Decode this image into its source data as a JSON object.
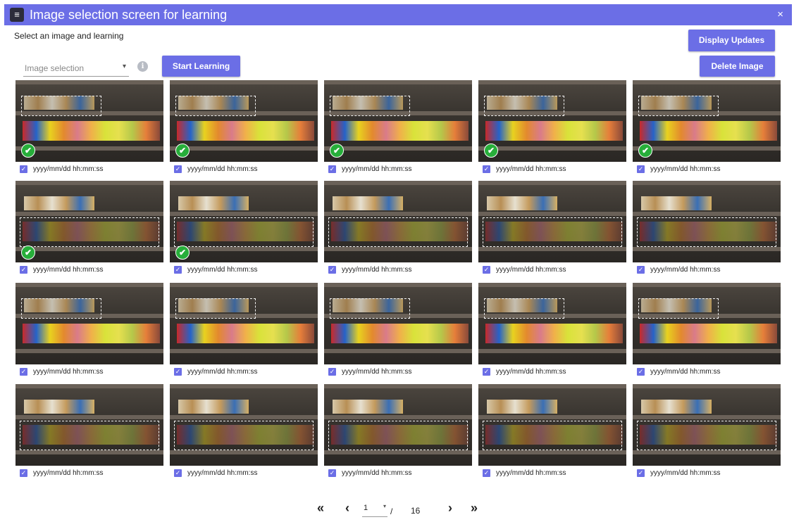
{
  "window": {
    "title": "Image selection screen for learning",
    "close_label": "×"
  },
  "subtitle": "Select an image and learning",
  "image_select": {
    "placeholder": "Image selection",
    "arrow": "▾"
  },
  "info_label": "i",
  "buttons": {
    "start": "Start Learning",
    "display": "Display Updates",
    "delete": "Delete Image"
  },
  "images": [
    {
      "timestamp": "yyyy/mm/dd hh:mm:ss",
      "checked": true,
      "learned": true,
      "variant": "a"
    },
    {
      "timestamp": "yyyy/mm/dd hh:mm:ss",
      "checked": true,
      "learned": true,
      "variant": "a"
    },
    {
      "timestamp": "yyyy/mm/dd hh:mm:ss",
      "checked": true,
      "learned": true,
      "variant": "a"
    },
    {
      "timestamp": "yyyy/mm/dd hh:mm:ss",
      "checked": true,
      "learned": true,
      "variant": "a"
    },
    {
      "timestamp": "yyyy/mm/dd hh:mm:ss",
      "checked": true,
      "learned": true,
      "variant": "a"
    },
    {
      "timestamp": "yyyy/mm/dd hh:mm:ss",
      "checked": true,
      "learned": true,
      "variant": "b"
    },
    {
      "timestamp": "yyyy/mm/dd hh:mm:ss",
      "checked": true,
      "learned": true,
      "variant": "b"
    },
    {
      "timestamp": "yyyy/mm/dd hh:mm:ss",
      "checked": true,
      "learned": false,
      "variant": "b"
    },
    {
      "timestamp": "yyyy/mm/dd hh:mm:ss",
      "checked": true,
      "learned": false,
      "variant": "b"
    },
    {
      "timestamp": "yyyy/mm/dd hh:mm:ss",
      "checked": true,
      "learned": false,
      "variant": "b"
    },
    {
      "timestamp": "yyyy/mm/dd hh:mm:ss",
      "checked": true,
      "learned": false,
      "variant": "a"
    },
    {
      "timestamp": "yyyy/mm/dd hh:mm:ss",
      "checked": true,
      "learned": false,
      "variant": "a"
    },
    {
      "timestamp": "yyyy/mm/dd hh:mm:ss",
      "checked": true,
      "learned": false,
      "variant": "a"
    },
    {
      "timestamp": "yyyy/mm/dd hh:mm:ss",
      "checked": true,
      "learned": false,
      "variant": "a"
    },
    {
      "timestamp": "yyyy/mm/dd hh:mm:ss",
      "checked": true,
      "learned": false,
      "variant": "a"
    },
    {
      "timestamp": "yyyy/mm/dd hh:mm:ss",
      "checked": true,
      "learned": false,
      "variant": "b"
    },
    {
      "timestamp": "yyyy/mm/dd hh:mm:ss",
      "checked": true,
      "learned": false,
      "variant": "b"
    },
    {
      "timestamp": "yyyy/mm/dd hh:mm:ss",
      "checked": true,
      "learned": false,
      "variant": "b"
    },
    {
      "timestamp": "yyyy/mm/dd hh:mm:ss",
      "checked": true,
      "learned": false,
      "variant": "b"
    },
    {
      "timestamp": "yyyy/mm/dd hh:mm:ss",
      "checked": true,
      "learned": false,
      "variant": "b"
    }
  ],
  "pagination": {
    "first": "«",
    "prev": "‹",
    "next": "›",
    "last": "»",
    "current": "1",
    "arrow": "▾",
    "separator": "/",
    "total": "16"
  },
  "colors": {
    "accent": "#6b6ee6",
    "learned_badge": "#27ae3a"
  }
}
